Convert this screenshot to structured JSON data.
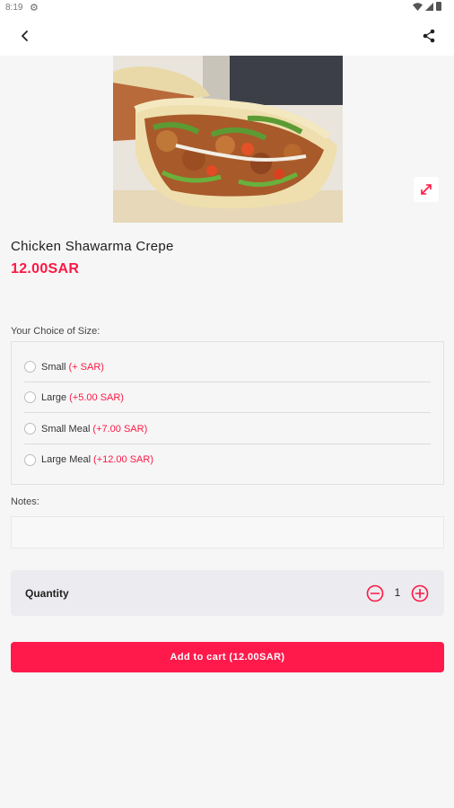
{
  "status_bar": {
    "time": "8:19"
  },
  "product": {
    "title": "Chicken Shawarma Crepe",
    "price": "12.00SAR"
  },
  "size_section": {
    "label": "Your Choice of Size:",
    "options": [
      {
        "name": "Small",
        "price": "(+ SAR)"
      },
      {
        "name": "Large",
        "price": "(+5.00 SAR)"
      },
      {
        "name": "Small Meal",
        "price": "(+7.00 SAR)"
      },
      {
        "name": "Large Meal",
        "price": "(+12.00 SAR)"
      }
    ]
  },
  "notes": {
    "label": "Notes:",
    "value": ""
  },
  "quantity": {
    "label": "Quantity",
    "value": "1"
  },
  "cart": {
    "button_label": "Add to cart (12.00SAR)"
  },
  "colors": {
    "accent": "#ff1744",
    "button": "#ff1a4b",
    "background": "#f6f6f6"
  },
  "icons": {
    "back": "arrow-left-icon",
    "share": "share-icon",
    "expand": "expand-icon",
    "minus": "minus-circle-icon",
    "plus": "plus-circle-icon"
  }
}
